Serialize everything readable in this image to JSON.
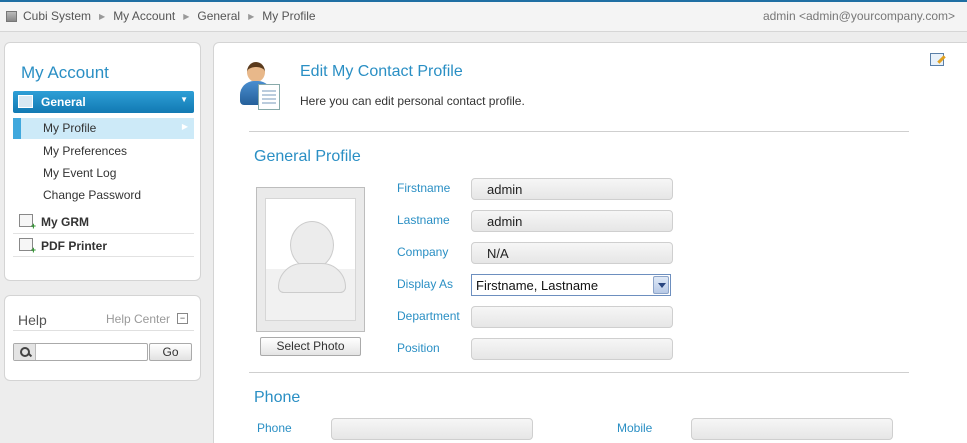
{
  "breadcrumb": [
    "Cubi System",
    "My Account",
    "General",
    "My Profile"
  ],
  "user": "admin <admin@yourcompany.com>",
  "sidebar": {
    "title": "My Account",
    "general_label": "General",
    "items": [
      {
        "label": "My Profile"
      },
      {
        "label": "My Preferences"
      },
      {
        "label": "My Event Log"
      },
      {
        "label": "Change Password"
      }
    ],
    "groups": [
      {
        "label": "My GRM"
      },
      {
        "label": "PDF Printer"
      }
    ]
  },
  "help": {
    "title": "Help",
    "center_link": "Help Center",
    "collapse": "−",
    "search_value": "",
    "go_label": "Go"
  },
  "main": {
    "title": "Edit My Contact Profile",
    "description": "Here you can edit personal contact profile.",
    "general_profile": "General Profile",
    "select_photo": "Select Photo",
    "fields": {
      "firstname": {
        "label": "Firstname",
        "value": "admin"
      },
      "lastname": {
        "label": "Lastname",
        "value": "admin"
      },
      "company": {
        "label": "Company",
        "value": "N/A"
      },
      "display_as": {
        "label": "Display As",
        "value": "Firstname, Lastname"
      },
      "department": {
        "label": "Department",
        "value": ""
      },
      "position": {
        "label": "Position",
        "value": ""
      }
    },
    "phone_section": "Phone",
    "phone": {
      "label": "Phone",
      "value": ""
    },
    "mobile": {
      "label": "Mobile",
      "value": ""
    }
  }
}
